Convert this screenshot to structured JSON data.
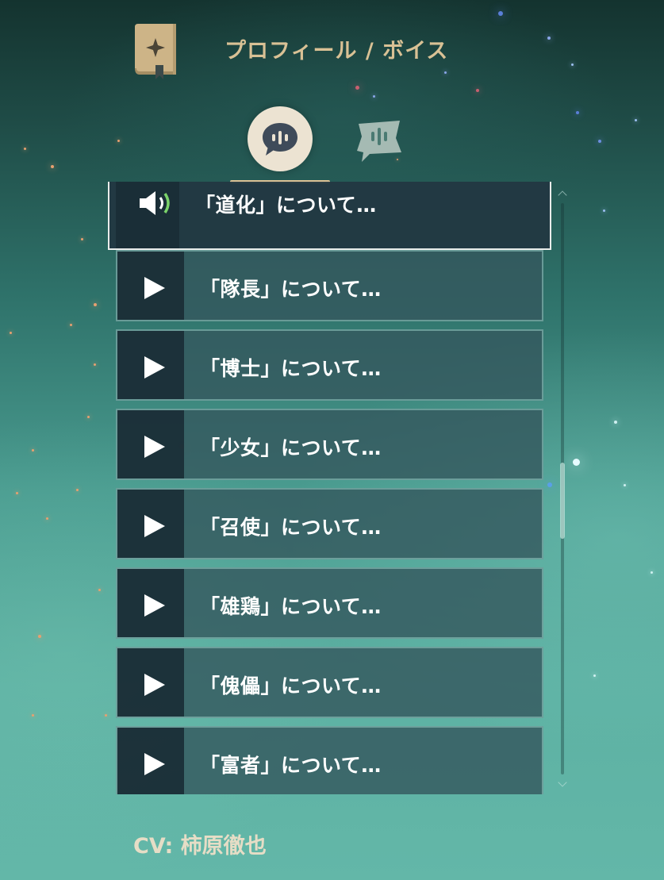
{
  "header": {
    "title": "プロフィール / ボイス",
    "icon": "profile-book-icon"
  },
  "tabs": [
    {
      "name": "voice-tab",
      "icon": "speech-bubble-waveform-icon",
      "selected": true
    },
    {
      "name": "story-tab",
      "icon": "speech-tag-waveform-icon",
      "selected": false
    }
  ],
  "voice_list": {
    "items": [
      {
        "label": "「道化」について…",
        "state": "playing",
        "icon": "speaker-icon"
      },
      {
        "label": "「隊長」について…",
        "state": "idle",
        "icon": "play-icon"
      },
      {
        "label": "「博士」について…",
        "state": "idle",
        "icon": "play-icon"
      },
      {
        "label": "「少女」について…",
        "state": "idle",
        "icon": "play-icon"
      },
      {
        "label": "「召使」について…",
        "state": "idle",
        "icon": "play-icon"
      },
      {
        "label": "「雄鶏」について…",
        "state": "idle",
        "icon": "play-icon"
      },
      {
        "label": "「傀儡」について…",
        "state": "idle",
        "icon": "play-icon"
      },
      {
        "label": "「富者」について…",
        "state": "idle",
        "icon": "play-icon"
      }
    ]
  },
  "footer": {
    "cv": "CV: 柿原徹也"
  },
  "colors": {
    "accent_gold": "#d9c195",
    "tab_active_bg": "#ece3d2",
    "item_bg": "#34585e",
    "item_active_border": "#e9ecea",
    "speaker_wave": "#7bd36a"
  }
}
